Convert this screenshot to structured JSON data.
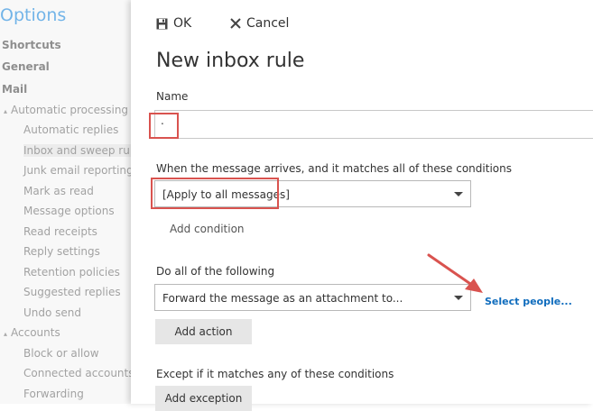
{
  "nav": {
    "title": "Options",
    "items": [
      {
        "label": "Shortcuts",
        "bold": true
      },
      {
        "label": "General",
        "bold": true
      },
      {
        "label": "Mail",
        "bold": true
      },
      {
        "label": "Automatic processing",
        "indent": 1,
        "expander": "▴"
      },
      {
        "label": "Automatic replies",
        "indent": 2
      },
      {
        "label": "Inbox and sweep rules",
        "indent": 2,
        "selected": true
      },
      {
        "label": "Junk email reporting",
        "indent": 2
      },
      {
        "label": "Mark as read",
        "indent": 2
      },
      {
        "label": "Message options",
        "indent": 2
      },
      {
        "label": "Read receipts",
        "indent": 2
      },
      {
        "label": "Reply settings",
        "indent": 2
      },
      {
        "label": "Retention policies",
        "indent": 2
      },
      {
        "label": "Suggested replies",
        "indent": 2
      },
      {
        "label": "Undo send",
        "indent": 2
      },
      {
        "label": "Accounts",
        "indent": 1,
        "expander": "▴"
      },
      {
        "label": "Block or allow",
        "indent": 2
      },
      {
        "label": "Connected accounts",
        "indent": 2
      },
      {
        "label": "Forwarding",
        "indent": 2
      }
    ]
  },
  "toolbar": {
    "ok_label": "OK",
    "cancel_label": "Cancel"
  },
  "page_title": "New inbox rule",
  "name_section": {
    "label": "Name",
    "value": "."
  },
  "conditions": {
    "label": "When the message arrives, and it matches all of these conditions",
    "selected": "[Apply to all messages]",
    "add_label": "Add condition"
  },
  "actions": {
    "label": "Do all of the following",
    "selected": "Forward the message as an attachment to...",
    "select_people": "Select people...",
    "add_label": "Add action"
  },
  "exceptions": {
    "label": "Except if it matches any of these conditions",
    "add_label": "Add exception"
  },
  "colors": {
    "accent": "#0078d7",
    "link": "#0f6cbd",
    "highlight": "#d9534f"
  }
}
